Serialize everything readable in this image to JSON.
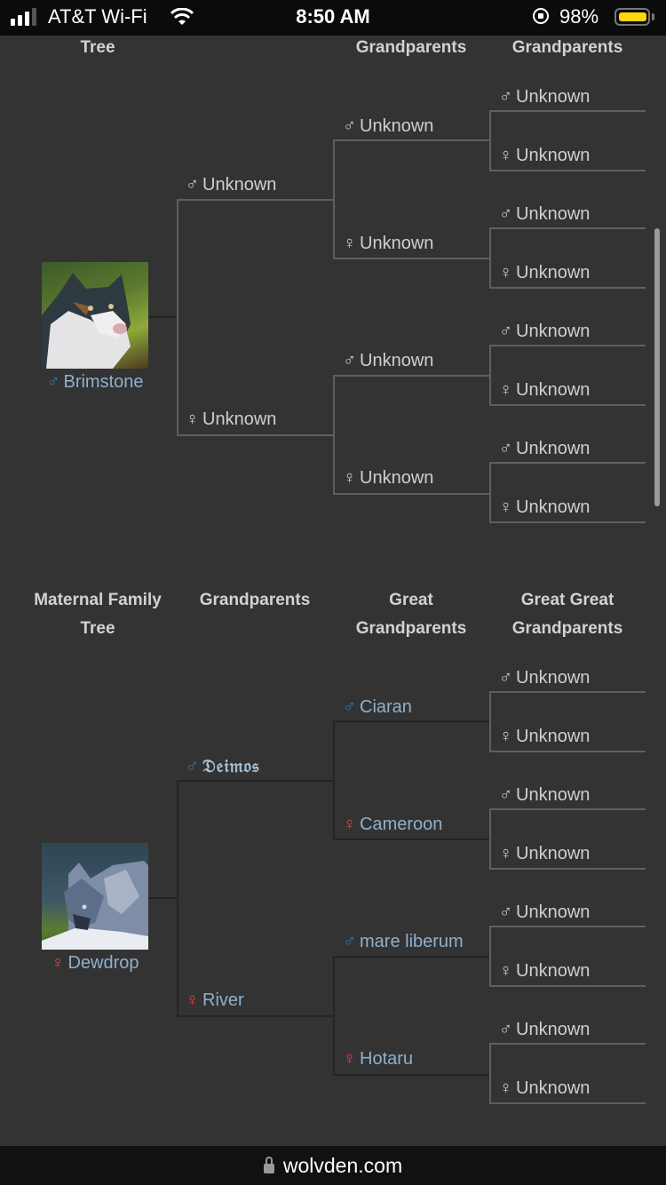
{
  "status_bar": {
    "carrier": "AT&T Wi-Fi",
    "time": "8:50 AM",
    "battery": "98%",
    "battery_level": 0.98
  },
  "symbols": {
    "male": "♂",
    "female": "♀"
  },
  "paternal": {
    "headers": {
      "col1": "Tree",
      "col3": "Grandparents",
      "col4": "Grandparents"
    },
    "subject": {
      "name": "Brimstone",
      "sex": "male",
      "avatar": "wolf-avatar-brimstone"
    },
    "parents": [
      {
        "name": "Unknown",
        "sex": "male",
        "known": false
      },
      {
        "name": "Unknown",
        "sex": "female",
        "known": false
      }
    ],
    "grandparents": [
      {
        "name": "Unknown",
        "sex": "male",
        "known": false
      },
      {
        "name": "Unknown",
        "sex": "female",
        "known": false
      },
      {
        "name": "Unknown",
        "sex": "male",
        "known": false
      },
      {
        "name": "Unknown",
        "sex": "female",
        "known": false
      }
    ],
    "great_grandparents": [
      {
        "name": "Unknown",
        "sex": "male"
      },
      {
        "name": "Unknown",
        "sex": "female"
      },
      {
        "name": "Unknown",
        "sex": "male"
      },
      {
        "name": "Unknown",
        "sex": "female"
      },
      {
        "name": "Unknown",
        "sex": "male"
      },
      {
        "name": "Unknown",
        "sex": "female"
      },
      {
        "name": "Unknown",
        "sex": "male"
      },
      {
        "name": "Unknown",
        "sex": "female"
      }
    ]
  },
  "maternal": {
    "headers": {
      "col1_line1": "Maternal Family",
      "col1_line2": "Tree",
      "col2": "Grandparents",
      "col3_line1": "Great",
      "col3_line2": "Grandparents",
      "col4_line1": "Great Great",
      "col4_line2": "Grandparents"
    },
    "subject": {
      "name": "Dewdrop",
      "sex": "female",
      "avatar": "wolf-avatar-dewdrop"
    },
    "parents": [
      {
        "name": "𝔇𝔢𝔦𝔪𝔬𝔰",
        "sex": "male",
        "known": true
      },
      {
        "name": "River",
        "sex": "female",
        "known": true
      }
    ],
    "grandparents": [
      {
        "name": "Ciaran",
        "sex": "male",
        "known": true
      },
      {
        "name": "Cameroon",
        "sex": "female",
        "known": true
      },
      {
        "name": "mare liberum",
        "sex": "male",
        "known": true
      },
      {
        "name": "Hotaru",
        "sex": "female",
        "known": true
      }
    ],
    "great_grandparents": [
      {
        "name": "Unknown",
        "sex": "male"
      },
      {
        "name": "Unknown",
        "sex": "female"
      },
      {
        "name": "Unknown",
        "sex": "male"
      },
      {
        "name": "Unknown",
        "sex": "female"
      },
      {
        "name": "Unknown",
        "sex": "male"
      },
      {
        "name": "Unknown",
        "sex": "female"
      },
      {
        "name": "Unknown",
        "sex": "male"
      },
      {
        "name": "Unknown",
        "sex": "female"
      }
    ]
  },
  "browser": {
    "url": "wolvden.com"
  }
}
